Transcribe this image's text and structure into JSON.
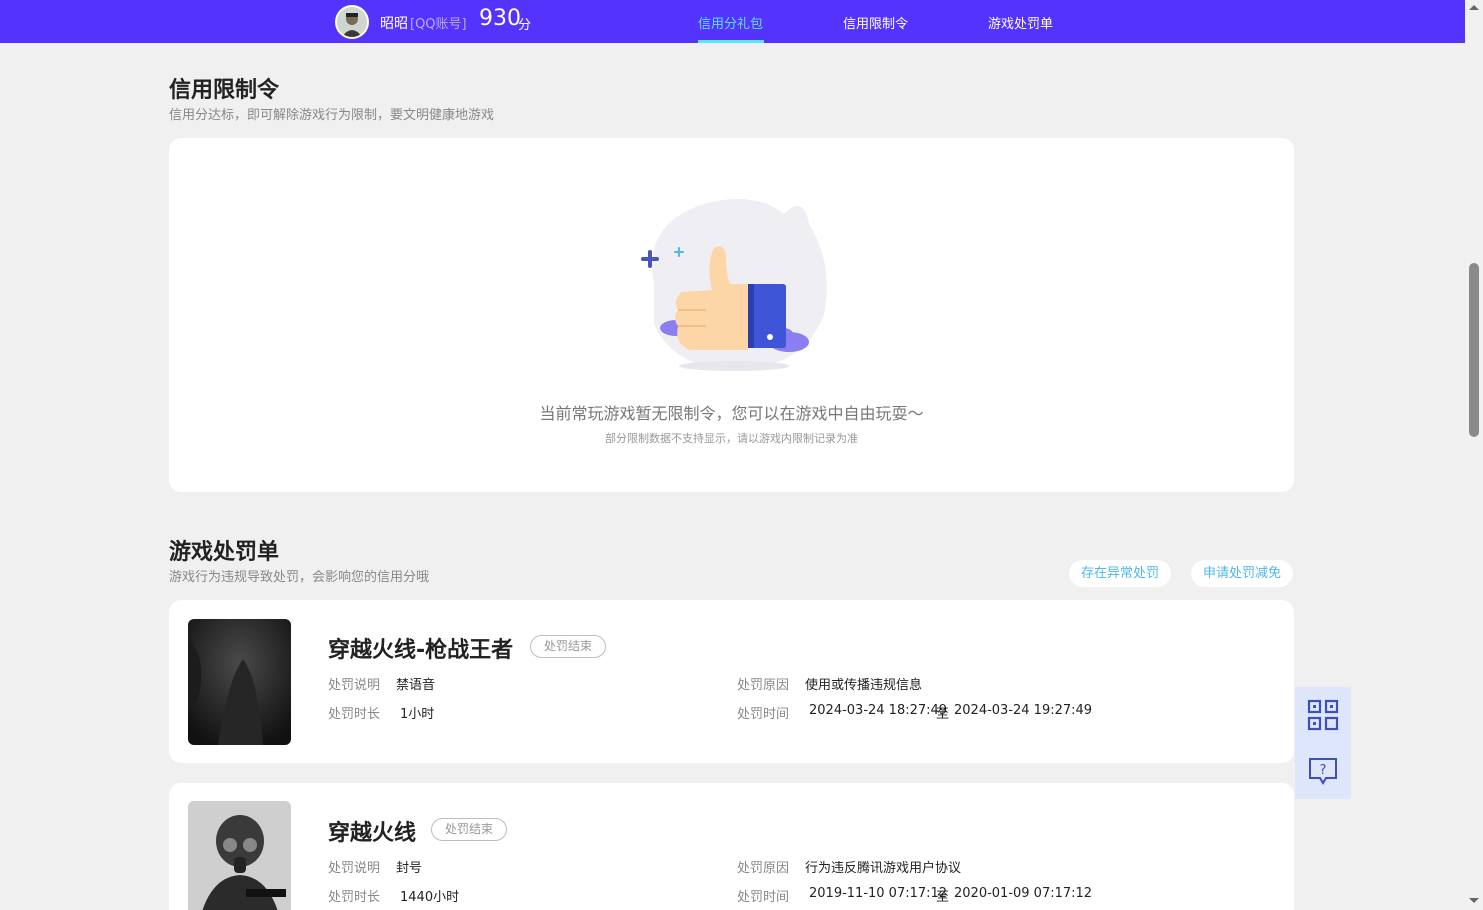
{
  "header": {
    "user_name": "昭昭",
    "account_type": "[QQ账号]",
    "score": "930",
    "score_unit": "分",
    "tabs": [
      {
        "label": "信用分礼包",
        "active": true
      },
      {
        "label": "信用限制令",
        "active": false
      },
      {
        "label": "游戏处罚单",
        "active": false
      }
    ]
  },
  "restriction": {
    "title": "信用限制令",
    "subtitle": "信用分达标，即可解除游戏行为限制，要文明健康地游戏",
    "empty_main": "当前常玩游戏暂无限制令，您可以在游戏中自由玩耍～",
    "empty_sub": "部分限制数据不支持显示，请以游戏内限制记录为准",
    "illustration_icon": "thumbs-up-icon"
  },
  "penalty": {
    "title": "游戏处罚单",
    "subtitle": "游戏行为违规导致处罚，会影响您的信用分哦",
    "btn_abnormal": "存在异常处罚",
    "btn_appeal": "申请处罚减免",
    "labels": {
      "desc": "处罚说明",
      "reason": "处罚原因",
      "duration": "处罚时长",
      "time": "处罚时间",
      "to": "至"
    },
    "items": [
      {
        "game": "穿越火线-枪战王者",
        "status": "处罚结束",
        "desc": "禁语音",
        "reason": "使用或传播违规信息",
        "duration": "1小时",
        "start": "2024-03-24 18:27:49",
        "end": "2024-03-24 19:27:49"
      },
      {
        "game": "穿越火线",
        "status": "处罚结束",
        "desc": "封号",
        "reason": "行为违反腾讯游戏用户协议",
        "duration": "1440小时",
        "start": "2019-11-10 07:17:12",
        "end": "2020-01-09 07:17:12"
      }
    ]
  },
  "side": {
    "qr_icon": "qr-code-icon",
    "help_icon": "help-chat-icon"
  },
  "colors": {
    "topbar": "#5533ff",
    "active_tab": "#5fe3ff",
    "link": "#4fb8e8",
    "page_bg": "#f0f0f0"
  }
}
